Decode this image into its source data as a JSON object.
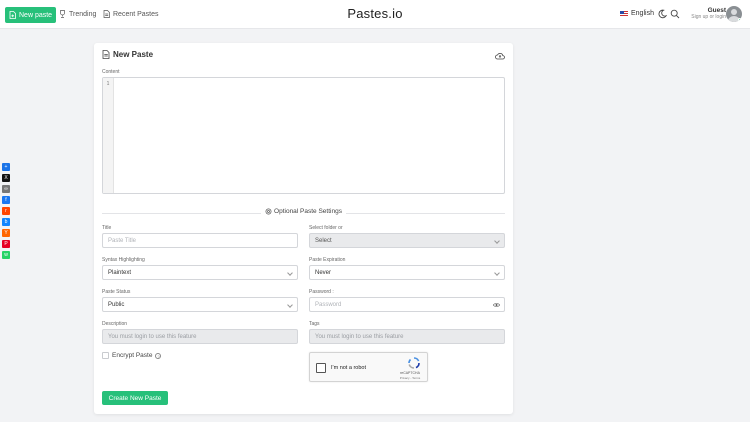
{
  "nav": {
    "new_paste": "New paste",
    "trending": "Trending",
    "recent": "Recent Pastes",
    "brand": "Pastes.io",
    "language": "English",
    "guest_name": "Guest",
    "guest_sub": "Sign up or login"
  },
  "share_icons": [
    "share-icon",
    "x-icon",
    "link-icon",
    "facebook-icon",
    "reddit-icon",
    "bluesky-icon",
    "hackernews-icon",
    "pinterest-icon",
    "whatsapp-icon"
  ],
  "card": {
    "title": "New Paste",
    "content_label": "Content",
    "line_number": "1",
    "settings_heading": "Optional Paste Settings",
    "title_label": "Title",
    "title_placeholder": "Paste Title",
    "folder_label": "Select folder or",
    "folder_value": "Select",
    "syntax_label": "Syntax Highlighting",
    "syntax_value": "Plaintext",
    "expiration_label": "Paste Expiration",
    "expiration_value": "Never",
    "status_label": "Paste Status",
    "status_value": "Public",
    "password_label": "Password :",
    "password_placeholder": "Password",
    "description_label": "Description",
    "description_placeholder": "You must login to use this feature",
    "tags_label": "Tags",
    "tags_placeholder": "You must login to use this feature",
    "encrypt_label": "Encrypt Paste",
    "captcha_text": "I'm not a robot",
    "captcha_brand": "reCAPTCHA",
    "captcha_links": "Privacy - Terms",
    "submit_label": "Create New Paste"
  },
  "colors": {
    "accent": "#27c07a",
    "background": "#f2f3f5"
  }
}
